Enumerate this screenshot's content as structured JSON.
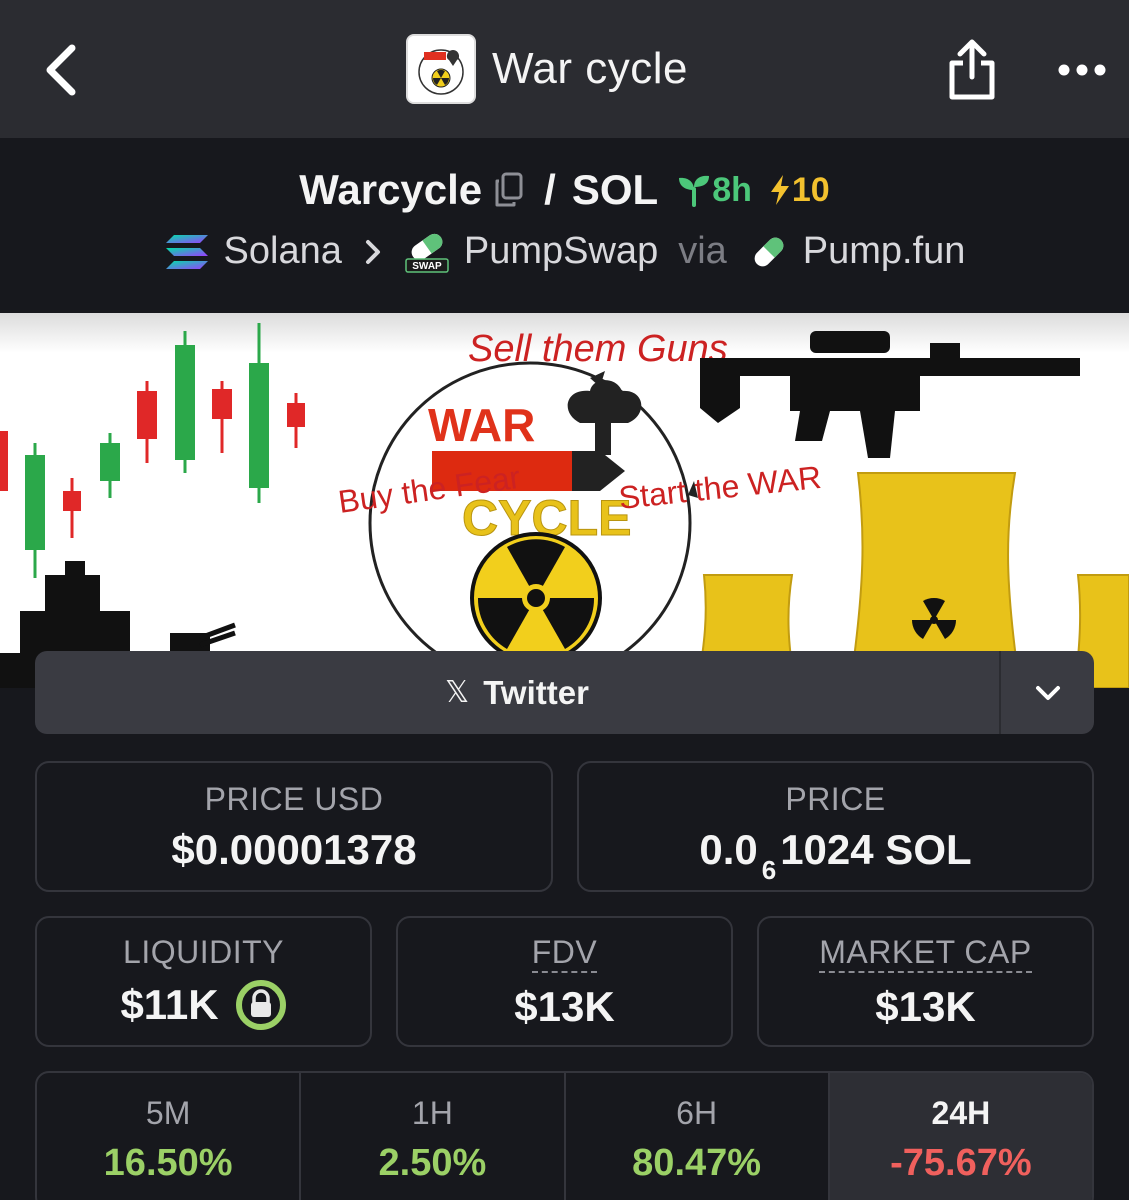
{
  "nav": {
    "title": "War cycle"
  },
  "token": {
    "base": "Warcycle",
    "separator": "/",
    "quote": "SOL",
    "age": "8h",
    "boosts": "10"
  },
  "chain": {
    "name": "Solana",
    "dex": "PumpSwap",
    "via": "via",
    "launchpad": "Pump.fun",
    "dex_badge": "SWAP"
  },
  "banner": {
    "top_text": "Sell them Guns",
    "war": "WAR",
    "cycle": "CYCLE",
    "left_text": "Buy the Fear",
    "right_text": "Start the WAR"
  },
  "social": {
    "label": "Twitter",
    "x_glyph": "𝕏"
  },
  "stats": {
    "price_usd_label": "PRICE USD",
    "price_usd": "$0.00001378",
    "price_label": "PRICE",
    "price_prefix": "0.0",
    "price_subscript": "6",
    "price_suffix": "1024 SOL",
    "liquidity_label": "LIQUIDITY",
    "liquidity": "$11K",
    "fdv_label": "FDV",
    "fdv": "$13K",
    "mcap_label": "MARKET CAP",
    "mcap": "$13K"
  },
  "changes": [
    {
      "label": "5M",
      "value": "16.50%",
      "trend": "pos"
    },
    {
      "label": "1H",
      "value": "2.50%",
      "trend": "pos"
    },
    {
      "label": "6H",
      "value": "80.47%",
      "trend": "pos"
    },
    {
      "label": "24H",
      "value": "-75.67%",
      "trend": "neg"
    }
  ],
  "colors": {
    "positive": "#9bd066",
    "negative": "#f0605d",
    "age_green": "#4cc77a",
    "boost_yellow": "#f3c12e"
  }
}
